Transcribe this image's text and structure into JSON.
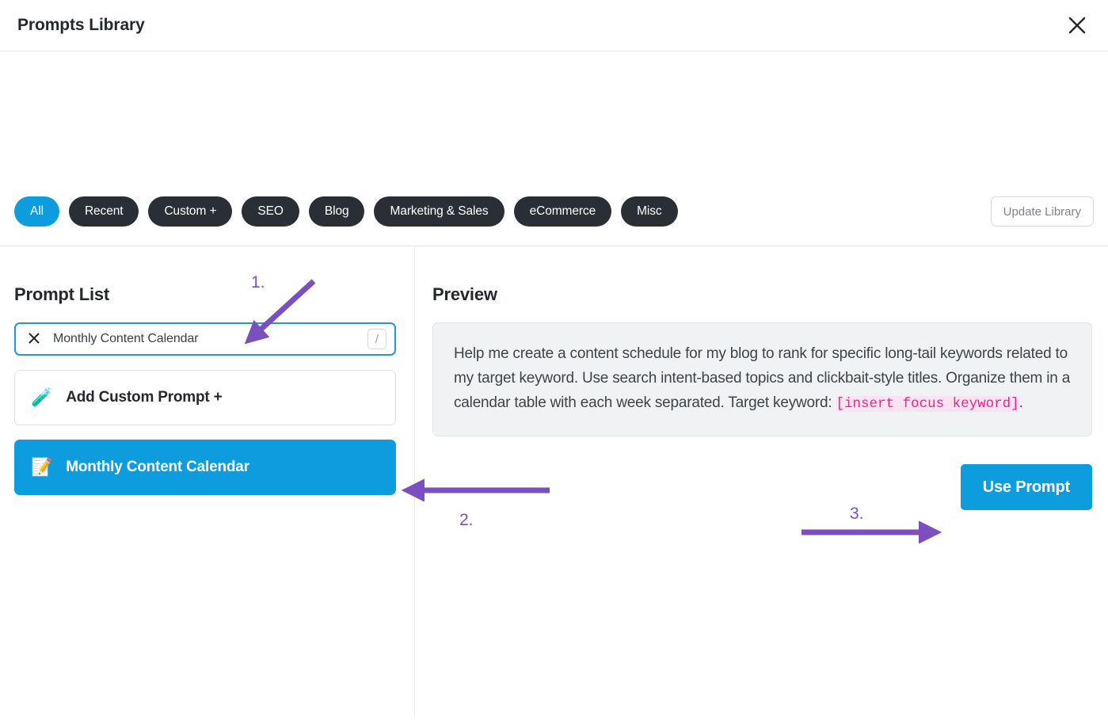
{
  "window": {
    "title": "Prompts Library",
    "close_icon": "close-icon"
  },
  "filters": {
    "pills": [
      {
        "label": "All",
        "active": true
      },
      {
        "label": "Recent",
        "active": false
      },
      {
        "label": "Custom +",
        "active": false
      },
      {
        "label": "SEO",
        "active": false
      },
      {
        "label": "Blog",
        "active": false
      },
      {
        "label": "Marketing & Sales",
        "active": false
      },
      {
        "label": "eCommerce",
        "active": false
      },
      {
        "label": "Misc",
        "active": false
      }
    ],
    "update_library_label": "Update Library"
  },
  "left_pane": {
    "heading": "Prompt List",
    "search": {
      "value": "Monthly Content Calendar",
      "placeholder": "Search prompts",
      "clear_icon": "close-icon",
      "shortcut_key": "/"
    },
    "items": [
      {
        "label": "Add Custom Prompt +",
        "emoji": "🧪",
        "emoji_name": "test-tube-icon",
        "selected": false
      },
      {
        "label": "Monthly Content Calendar",
        "emoji": "📝",
        "emoji_name": "memo-icon",
        "selected": true
      }
    ]
  },
  "right_pane": {
    "heading": "Preview",
    "prompt_text_before": "Help me create a content schedule for my blog to rank for specific long-tail keywords related to my target keyword. Use search intent-based topics and clickbait-style titles. Organize them in a calendar table with each week separated. Target keyword: ",
    "prompt_placeholder_token": "[insert focus keyword]",
    "prompt_text_after": ".",
    "use_prompt_label": "Use Prompt"
  },
  "annotations": [
    {
      "id": "anno-1",
      "label": "1."
    },
    {
      "id": "anno-2",
      "label": "2."
    },
    {
      "id": "anno-3",
      "label": "3."
    }
  ],
  "colors": {
    "accent_blue": "#0d9ddf",
    "pill_dark": "#2a2f36",
    "annotation_purple": "#7b4fc0",
    "placeholder_pink": "#e8258f",
    "placeholder_pink_bg": "#fde3f1"
  }
}
